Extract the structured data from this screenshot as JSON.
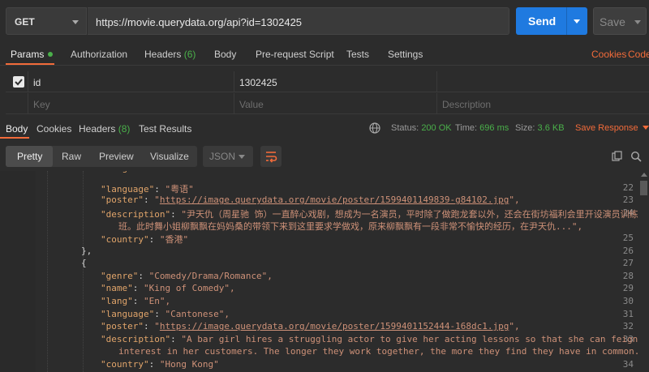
{
  "request": {
    "method": "GET",
    "url": "https://movie.querydata.org/api?id=1302425",
    "send_label": "Send",
    "save_label": "Save"
  },
  "request_tabs": {
    "params": "Params",
    "authorization": "Authorization",
    "headers": "Headers",
    "headers_count": "(6)",
    "body": "Body",
    "prerequest": "Pre-request Script",
    "tests": "Tests",
    "settings": "Settings",
    "cookies": "Cookies",
    "code": "Code"
  },
  "params": {
    "row": {
      "key": "id",
      "value": "1302425",
      "checked": true
    },
    "placeholder": {
      "key": "Key",
      "value": "Value",
      "description": "Description"
    }
  },
  "response_tabs": {
    "body": "Body",
    "cookies": "Cookies",
    "headers": "Headers",
    "headers_count": "(8)",
    "test_results": "Test Results"
  },
  "status": {
    "status_label": "Status:",
    "status_value": "200 OK",
    "time_label": "Time:",
    "time_value": "696 ms",
    "size_label": "Size:",
    "size_value": "3.6 KB",
    "save_response": "Save Response"
  },
  "format": {
    "pretty": "Pretty",
    "raw": "Raw",
    "preview": "Preview",
    "visualize": "Visualize",
    "language": "JSON"
  },
  "code_lines": [
    {
      "n": "",
      "indent": 2,
      "key": "lang",
      "value": "\"Yu\"",
      "partial": true
    },
    {
      "n": "22",
      "indent": 2,
      "key": "language",
      "value": "\"粤语\""
    },
    {
      "n": "23",
      "indent": 2,
      "key": "poster",
      "value": "https://image.querydata.org/movie/poster/1599401149839-g84102.jpg",
      "link": true
    },
    {
      "n": "24",
      "indent": 2,
      "key": "description",
      "value": "\"尹天仇（周星驰 饰）一直醉心戏剧，想成为一名演员，平时除了做跑龙套以外，还会在街坊福利会里开设演员训练",
      "cont": "班。此时舞小姐柳飘飘在妈妈桑的带领下来到这里要求学做戏，原来柳飘飘有一段非常不愉快的经历，在尹天仇...\","
    },
    {
      "n": "25",
      "indent": 2,
      "key": "country",
      "value": "\"香港\""
    },
    {
      "n": "26",
      "indent": 1,
      "text": "},"
    },
    {
      "n": "27",
      "indent": 1,
      "text": "{"
    },
    {
      "n": "28",
      "indent": 2,
      "key": "genre",
      "value": "\"Comedy/Drama/Romance\","
    },
    {
      "n": "29",
      "indent": 2,
      "key": "name",
      "value": "\"King of Comedy\","
    },
    {
      "n": "30",
      "indent": 2,
      "key": "lang",
      "value": "\"En\","
    },
    {
      "n": "31",
      "indent": 2,
      "key": "language",
      "value": "\"Cantonese\","
    },
    {
      "n": "32",
      "indent": 2,
      "key": "poster",
      "value": "https://image.querydata.org/movie/poster/1599401152444-168dc1.jpg",
      "link": true
    },
    {
      "n": "33",
      "indent": 2,
      "key": "description",
      "value": "\"A bar girl hires a struggling actor to give her acting lessons so that she can feign a greater",
      "cont": "interest in her customers. The longer they work together, the more they find they have in common.\","
    },
    {
      "n": "34",
      "indent": 2,
      "key": "country",
      "value": "\"Hong Kong\""
    }
  ],
  "colors": {
    "accent": "#f26b3a",
    "send": "#1f7ae0",
    "ok": "#4ab04a"
  }
}
